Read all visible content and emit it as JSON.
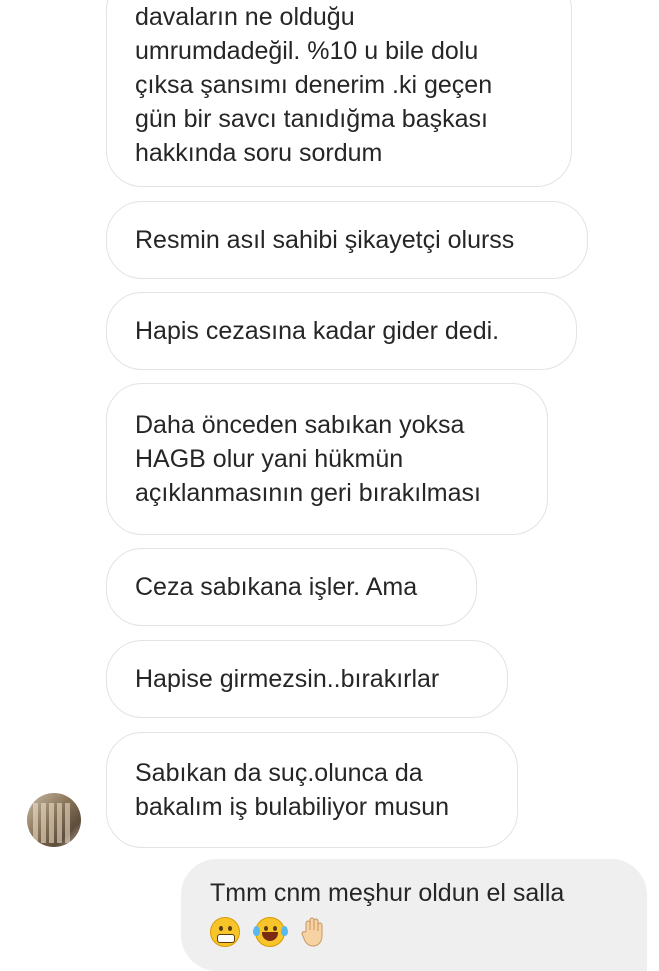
{
  "conversation": {
    "messages": [
      {
        "sender": "other",
        "lines": [
          "davaların ne olduğu",
          "umrumdadeğil. %10 u bile dolu",
          "çıksa şansımı denerim .ki geçen",
          "gün bir savcı tanıdığma başkası",
          "hakkında soru sordum"
        ]
      },
      {
        "sender": "other",
        "lines": [
          "Resmin asıl sahibi şikayetçi olurss"
        ]
      },
      {
        "sender": "other",
        "lines": [
          "Hapis cezasına kadar gider dedi."
        ]
      },
      {
        "sender": "other",
        "lines": [
          "Daha önceden sabıkan yoksa",
          "HAGB olur yani hükmün",
          "açıklanmasının geri bırakılması"
        ]
      },
      {
        "sender": "other",
        "lines": [
          "Ceza sabıkana işler. Ama"
        ]
      },
      {
        "sender": "other",
        "lines": [
          "Hapise girmezsin..bırakırlar"
        ]
      },
      {
        "sender": "other",
        "lines": [
          "Sabıkan da suç.olunca da",
          "bakalım iş bulabiliyor musun"
        ]
      },
      {
        "sender": "me",
        "lines": [
          "Tmm cnm meşhur oldun el salla"
        ],
        "emojis": [
          "grimacing-face",
          "face-with-tears-of-joy",
          "raised-hand"
        ]
      }
    ]
  },
  "colors": {
    "received_bubble_bg": "#ffffff",
    "received_bubble_border": "#e3e3e3",
    "sent_bubble_bg": "#efefef",
    "text": "#262626"
  }
}
